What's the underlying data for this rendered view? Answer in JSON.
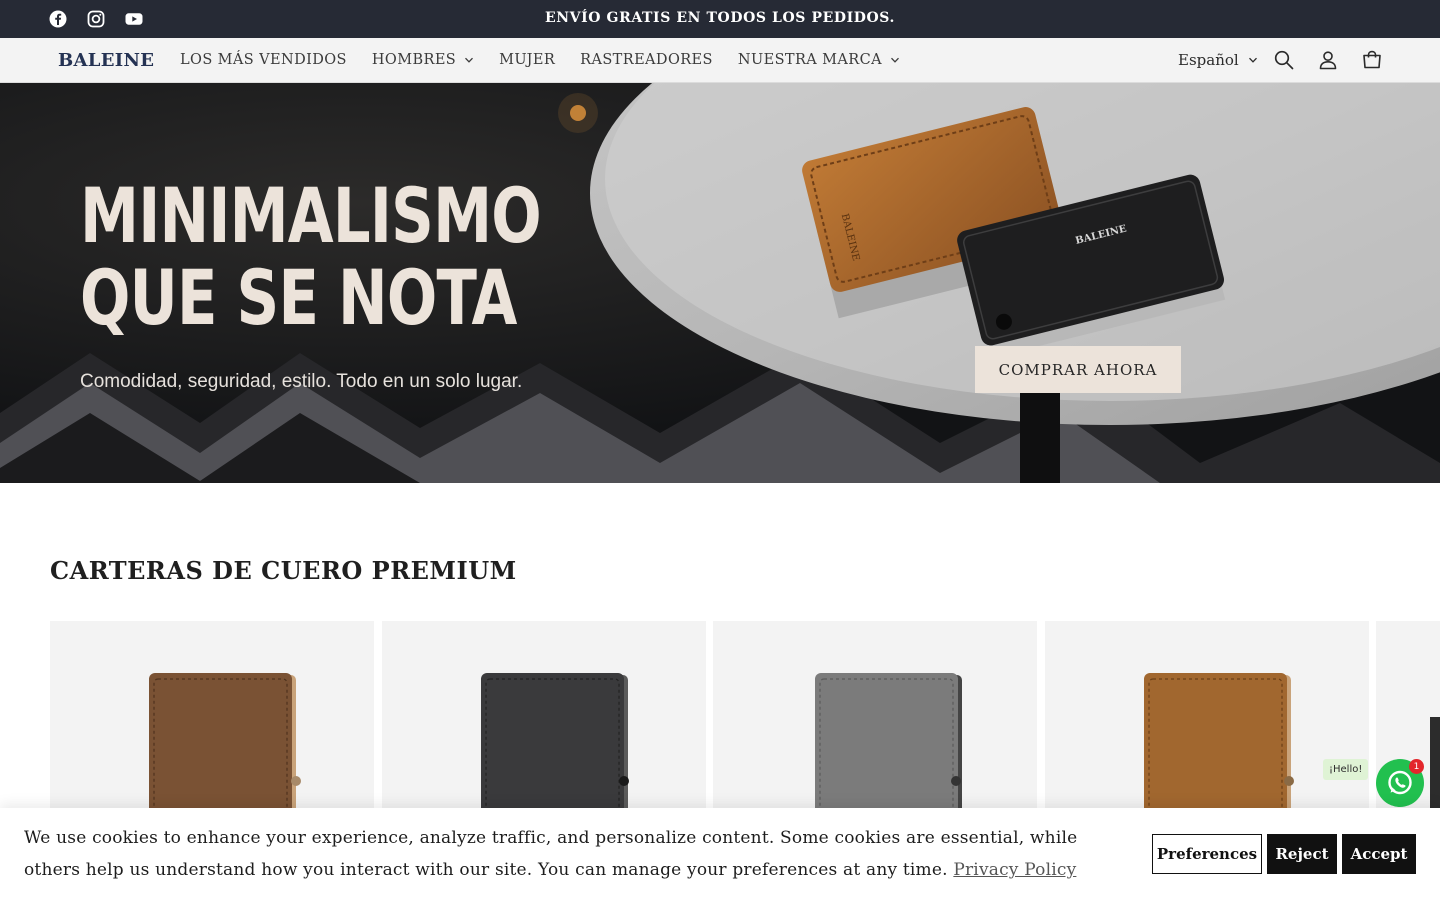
{
  "announcement": {
    "text": "ENVÍO GRATIS EN TODOS LOS PEDIDOS.",
    "social": [
      "facebook-icon",
      "instagram-icon",
      "youtube-icon"
    ]
  },
  "header": {
    "logo": "BALEINE",
    "nav": [
      {
        "label": "LOS MÁS VENDIDOS",
        "dropdown": false
      },
      {
        "label": "HOMBRES",
        "dropdown": true
      },
      {
        "label": "MUJER",
        "dropdown": false
      },
      {
        "label": "RASTREADORES",
        "dropdown": false
      },
      {
        "label": "NUESTRA MARCA",
        "dropdown": true
      }
    ],
    "language": "Español",
    "icons": [
      "search-icon",
      "account-icon",
      "cart-icon"
    ]
  },
  "hero": {
    "title_line1": "MINIMALISMO",
    "title_line2": "QUE SE NOTA",
    "subtitle": "Comodidad, seguridad, estilo. Todo en un solo lugar.",
    "cta": "COMPRAR AHORA",
    "wallet_label_brand": "BALEINE"
  },
  "section": {
    "title": "CARTERAS DE CUERO PREMIUM",
    "products": [
      {
        "color_name": "brown",
        "color": "#7a5234"
      },
      {
        "color_name": "black",
        "color": "#3a3a3c"
      },
      {
        "color_name": "grey",
        "color": "#7b7b7b"
      },
      {
        "color_name": "tan",
        "color": "#a1672f"
      }
    ]
  },
  "whatsapp": {
    "bubble": "¡Hello!",
    "badge": "1"
  },
  "cookie": {
    "text": "We use cookies to enhance your experience, analyze traffic, and personalize content. Some cookies are essential, while others help us understand how you interact with our site. You can manage your preferences at any time.",
    "link": "Privacy Policy",
    "preferences": "Preferences",
    "reject": "Reject",
    "accept": "Accept"
  },
  "colors": {
    "announcement_bg": "#262a35",
    "header_bg": "#f3f3f3",
    "logo": "#243253",
    "hero_text": "#ece3da",
    "whatsapp": "#22c04f"
  }
}
